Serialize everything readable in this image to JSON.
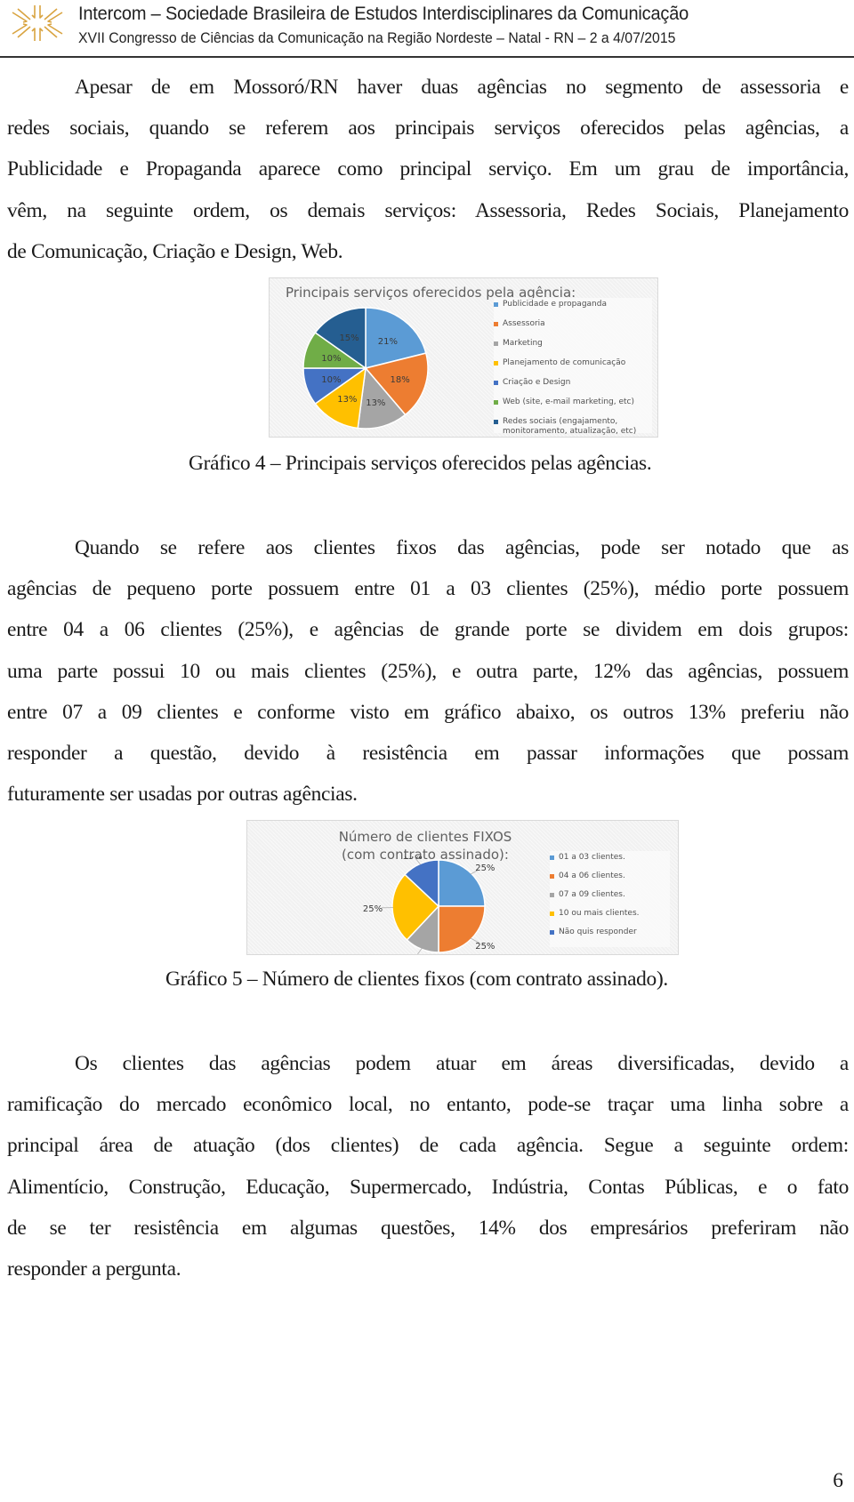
{
  "header": {
    "logo_icon": "intercom-star-logo",
    "title": "Intercom – Sociedade Brasileira de Estudos Interdisciplinares da Comunicação",
    "subtitle": "XVII Congresso de Ciências da Comunicação na Região Nordeste – Natal - RN – 2 a 4/07/2015"
  },
  "paragraphs": [
    {
      "lines": [
        "Apesar de em Mossoró/RN haver duas agências no segmento de assessoria e",
        "redes sociais, quando se referem aos principais serviços oferecidos pelas agências, a",
        "Publicidade e Propaganda aparece como principal serviço. Em um grau de importância,",
        "vêm, na seguinte ordem, os demais serviços: Assessoria, Redes Sociais, Planejamento",
        "de Comunicação, Criação e Design, Web."
      ]
    },
    {
      "lines": [
        "Quando se refere aos clientes fixos das agências, pode ser notado que as",
        "agências de pequeno porte possuem entre 01 a 03 clientes (25%), médio porte possuem",
        "entre 04 a 06 clientes (25%), e agências de grande porte se dividem em dois grupos:",
        "uma parte possui 10 ou mais clientes (25%), e outra parte, 12% das agências, possuem",
        "entre 07 a 09 clientes e conforme visto em gráfico abaixo, os outros 13% preferiu não",
        "responder a questão, devido à resistência em passar informações que possam",
        "futuramente ser  usadas por outras agências."
      ]
    },
    {
      "lines": [
        "Os clientes das agências podem atuar em áreas diversificadas, devido a",
        "ramificação do mercado econômico local, no entanto, pode-se traçar uma linha sobre a",
        "principal área de atuação (dos clientes) de cada agência. Segue a seguinte ordem:",
        "Alimentício, Construção, Educação, Supermercado, Indústria, Contas Públicas, e o fato",
        "de se ter resistência em algumas questões, 14% dos empresários preferiram não",
        "responder a pergunta."
      ]
    }
  ],
  "captions": {
    "chart4": "Gráfico 4 – Principais serviços oferecidos pelas agências.",
    "chart5": "Gráfico 5 – Número de clientes fixos (com contrato assinado)."
  },
  "page_number": "6",
  "chart_data": [
    {
      "type": "pie",
      "title": "Principais serviços oferecidos pela agência:",
      "legend_position": "right",
      "categories": [
        "Publicidade e propaganda",
        "Assessoria",
        "Marketing",
        "Planejamento de comunicação",
        "Criação e Design",
        "Web (site, e-mail marketing, etc)",
        "Redes sociais (engajamento, monitoramento, atualização, etc)"
      ],
      "legend_lines": [
        [
          "Publicidade e propaganda"
        ],
        [
          "Assessoria"
        ],
        [
          "Marketing"
        ],
        [
          "Planejamento de comunicação"
        ],
        [
          "Criação e Design"
        ],
        [
          "Web (site, e-mail marketing, etc)"
        ],
        [
          "Redes sociais (engajamento,",
          "monitoramento, atualização, etc)"
        ]
      ],
      "values": [
        21,
        18,
        13,
        13,
        10,
        10,
        15
      ],
      "labels": [
        "21%",
        "18%",
        "13%",
        "13%",
        "10%",
        "10%",
        "15%"
      ],
      "colors": [
        "#5b9bd5",
        "#ed7d31",
        "#a5a5a5",
        "#ffc000",
        "#4472c4",
        "#70ad47",
        "#255e91"
      ]
    },
    {
      "type": "pie",
      "title": "Número de clientes FIXOS (com contrato assinado):",
      "legend_position": "right",
      "categories": [
        "01 a 03 clientes.",
        "04 a 06 clientes.",
        "07 a 09 clientes.",
        "10 ou mais clientes.",
        "Não quis responder"
      ],
      "values": [
        25,
        25,
        12,
        25,
        13
      ],
      "labels": [
        "25%",
        "25%",
        "12%",
        "25%",
        "13%"
      ],
      "colors": [
        "#5b9bd5",
        "#ed7d31",
        "#a5a5a5",
        "#ffc000",
        "#4472c4"
      ]
    }
  ]
}
